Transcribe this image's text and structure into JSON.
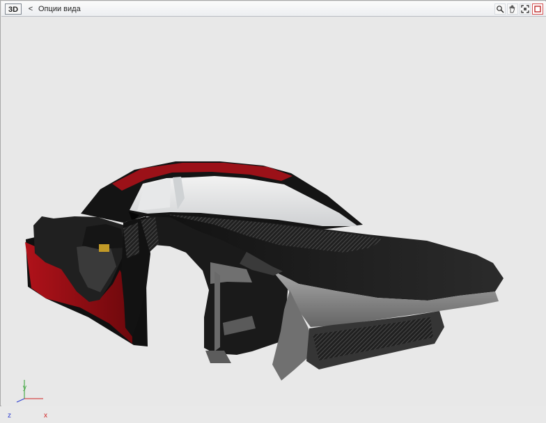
{
  "toolbar": {
    "mode_label": "3D",
    "back_label": "<",
    "title": "Опции вида"
  },
  "viewport": {
    "axis_labels": {
      "x": "x",
      "y": "y",
      "z": "z"
    }
  },
  "icons": {
    "zoom": "magnifier-icon",
    "pan": "hand-icon",
    "fit": "frame-icon",
    "close": "close-icon"
  },
  "colors": {
    "body_red": "#9d0c12",
    "dark_body": "#111111",
    "carbon": "#2b2b2b",
    "glass": "#dfe1e3",
    "axis_x": "#d02020",
    "axis_y": "#2b9e2b",
    "axis_z": "#2a3ccf"
  }
}
